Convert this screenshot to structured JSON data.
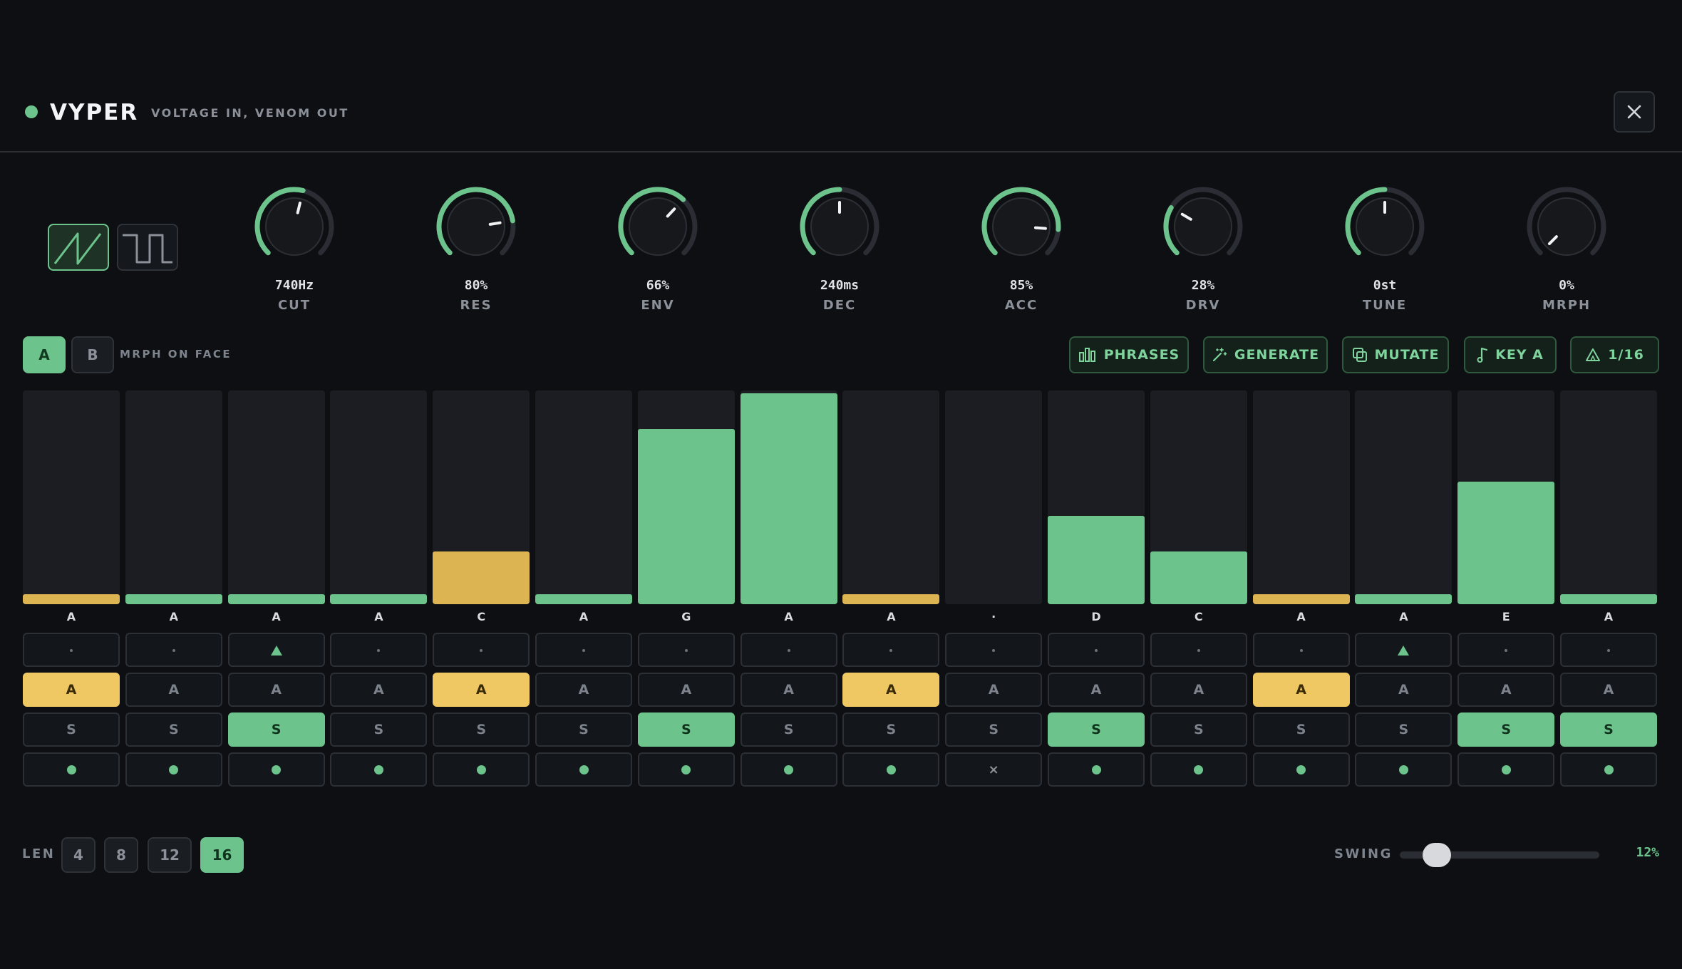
{
  "header": {
    "title": "VYPER",
    "tagline": "VOLTAGE IN, VENOM OUT",
    "close_icon": "close-icon"
  },
  "waveforms": [
    {
      "name": "saw",
      "icon": "saw-wave-icon",
      "active": true
    },
    {
      "name": "square",
      "icon": "square-wave-icon",
      "active": false
    }
  ],
  "knobs": [
    {
      "value": "740Hz",
      "label": "CUT",
      "level": 0.55
    },
    {
      "value": "80%",
      "label": "RES",
      "level": 0.8
    },
    {
      "value": "66%",
      "label": "ENV",
      "level": 0.66
    },
    {
      "value": "240ms",
      "label": "DEC",
      "level": 0.5
    },
    {
      "value": "85%",
      "label": "ACC",
      "level": 0.85
    },
    {
      "value": "28%",
      "label": "DRV",
      "level": 0.28
    },
    {
      "value": "0st",
      "label": "TUNE",
      "level": 0.5
    },
    {
      "value": "0%",
      "label": "MRPH",
      "level": 0.0
    }
  ],
  "pattern": {
    "a_label": "A",
    "b_label": "B",
    "active": "A",
    "morph_label": "MRPH ON FACE"
  },
  "toolbar": {
    "phrases": "PHRASES",
    "generate": "GENERATE",
    "mutate": "MUTATE",
    "key": "KEY A",
    "division": "1/16"
  },
  "steps": [
    {
      "note": "A",
      "level": 0.0,
      "color": "amber",
      "oct": "",
      "accent": true,
      "slide": false,
      "gate": true
    },
    {
      "note": "A",
      "level": 0.0,
      "color": "green",
      "oct": "",
      "accent": false,
      "slide": false,
      "gate": true
    },
    {
      "note": "A",
      "level": 0.0,
      "color": "green",
      "oct": "up",
      "accent": false,
      "slide": true,
      "gate": true
    },
    {
      "note": "A",
      "level": 0.0,
      "color": "green",
      "oct": "",
      "accent": false,
      "slide": false,
      "gate": true
    },
    {
      "note": "C",
      "level": 0.25,
      "color": "amber",
      "oct": "",
      "accent": true,
      "slide": false,
      "gate": true
    },
    {
      "note": "A",
      "level": 0.0,
      "color": "green",
      "oct": "",
      "accent": false,
      "slide": false,
      "gate": true
    },
    {
      "note": "G",
      "level": 0.83,
      "color": "green",
      "oct": "",
      "accent": false,
      "slide": true,
      "gate": true
    },
    {
      "note": "A",
      "level": 1.0,
      "color": "green",
      "oct": "",
      "accent": false,
      "slide": false,
      "gate": true
    },
    {
      "note": "A",
      "level": 0.0,
      "color": "amber",
      "oct": "",
      "accent": true,
      "slide": false,
      "gate": true
    },
    {
      "note": "·",
      "level": 0.0,
      "color": "none",
      "oct": "",
      "accent": false,
      "slide": false,
      "gate": false
    },
    {
      "note": "D",
      "level": 0.42,
      "color": "green",
      "oct": "",
      "accent": false,
      "slide": true,
      "gate": true
    },
    {
      "note": "C",
      "level": 0.25,
      "color": "green",
      "oct": "",
      "accent": false,
      "slide": false,
      "gate": true
    },
    {
      "note": "A",
      "level": 0.0,
      "color": "amber",
      "oct": "",
      "accent": true,
      "slide": false,
      "gate": true
    },
    {
      "note": "A",
      "level": 0.0,
      "color": "green",
      "oct": "up",
      "accent": false,
      "slide": false,
      "gate": true
    },
    {
      "note": "E",
      "level": 0.58,
      "color": "green",
      "oct": "",
      "accent": false,
      "slide": true,
      "gate": true
    },
    {
      "note": "A",
      "level": 0.0,
      "color": "green",
      "oct": "",
      "accent": false,
      "slide": true,
      "gate": true
    }
  ],
  "row_labels": {
    "accent": "A",
    "slide": "S",
    "gate_off": "×"
  },
  "footer": {
    "len_label": "LEN",
    "lengths": [
      "4",
      "8",
      "12",
      "16"
    ],
    "active_length": "16",
    "swing_label": "SWING",
    "swing_value": "12%",
    "swing_level": 0.12
  },
  "colors": {
    "accent_green": "#6cc48c",
    "amber": "#dcb452",
    "accent_yellow": "#f0c863",
    "background": "#0d0f13"
  }
}
